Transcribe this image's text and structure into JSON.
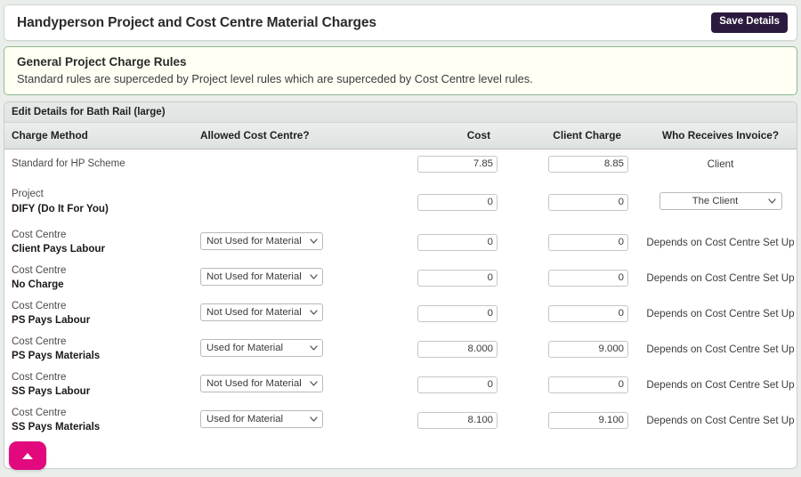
{
  "header": {
    "title": "Handyperson Project and Cost Centre Material Charges",
    "save_label": "Save Details"
  },
  "rules_panel": {
    "title": "General Project Charge Rules",
    "subtitle": "Standard rules are superceded by Project level rules which are superceded by Cost Centre level rules."
  },
  "table": {
    "caption": "Edit Details for Bath Rail (large)",
    "columns": {
      "method": "Charge Method",
      "allowed": "Allowed Cost Centre?",
      "cost": "Cost",
      "client_charge": "Client Charge",
      "who": "Who Receives Invoice?"
    },
    "rows": [
      {
        "kind": "",
        "name": "Standard for HP Scheme",
        "allowed": null,
        "cost": "7.85",
        "client_charge": "8.85",
        "who_text": "Client",
        "who_select": null
      },
      {
        "kind": "Project",
        "name": "DIFY (Do It For You)",
        "allowed": null,
        "cost": "0",
        "client_charge": "0",
        "who_text": null,
        "who_select": "The Client"
      },
      {
        "kind": "Cost Centre",
        "name": "Client Pays Labour",
        "allowed": "Not Used for Material",
        "cost": "0",
        "client_charge": "0",
        "who_text": "Depends on Cost Centre Set Up",
        "who_select": null
      },
      {
        "kind": "Cost Centre",
        "name": "No Charge",
        "allowed": "Not Used for Material",
        "cost": "0",
        "client_charge": "0",
        "who_text": "Depends on Cost Centre Set Up",
        "who_select": null
      },
      {
        "kind": "Cost Centre",
        "name": "PS Pays Labour",
        "allowed": "Not Used for Material",
        "cost": "0",
        "client_charge": "0",
        "who_text": "Depends on Cost Centre Set Up",
        "who_select": null
      },
      {
        "kind": "Cost Centre",
        "name": "PS Pays Materials",
        "allowed": "Used for Material",
        "cost": "8.000",
        "client_charge": "9.000",
        "who_text": "Depends on Cost Centre Set Up",
        "who_select": null
      },
      {
        "kind": "Cost Centre",
        "name": "SS Pays Labour",
        "allowed": "Not Used for Material",
        "cost": "0",
        "client_charge": "0",
        "who_text": "Depends on Cost Centre Set Up",
        "who_select": null
      },
      {
        "kind": "Cost Centre",
        "name": "SS Pays Materials",
        "allowed": "Used for Material",
        "cost": "8.100",
        "client_charge": "9.100",
        "who_text": "Depends on Cost Centre Set Up",
        "who_select": null
      }
    ]
  },
  "scroll_top": {
    "icon": "triangle-up-icon"
  },
  "colors": {
    "accent_button": "#2b1a3d",
    "scroll_top": "#e2097f",
    "rules_border": "#8fb98f",
    "rules_bg": "#fffff4"
  }
}
